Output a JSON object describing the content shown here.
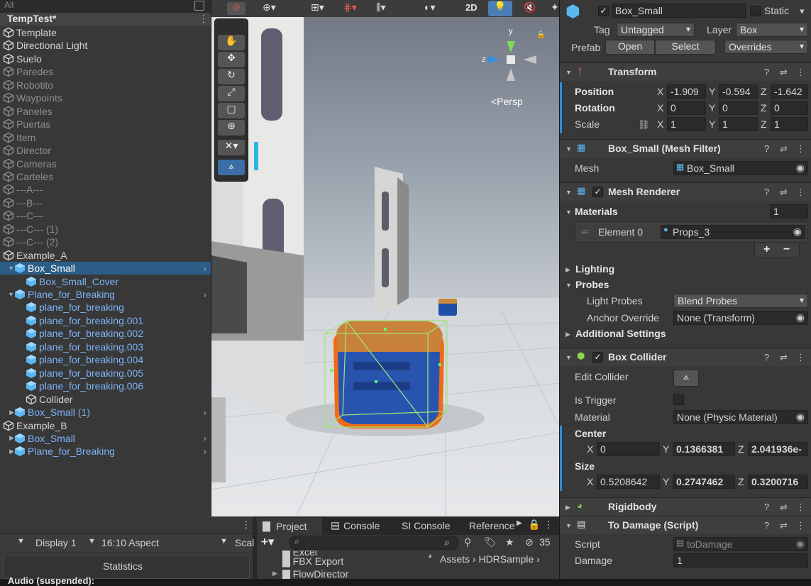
{
  "hierarchy": {
    "search_placeholder": "All",
    "scene_name": "TempTest*",
    "items": [
      {
        "label": "Template",
        "style": "normal"
      },
      {
        "label": "Directional Light",
        "style": "normal"
      },
      {
        "label": "Suelo",
        "style": "normal"
      },
      {
        "label": "Paredes",
        "style": "dim"
      },
      {
        "label": "Robotito",
        "style": "dim"
      },
      {
        "label": "Waypoints",
        "style": "dim"
      },
      {
        "label": "Paneles",
        "style": "dim"
      },
      {
        "label": "Puertas",
        "style": "dim"
      },
      {
        "label": "Item",
        "style": "dim"
      },
      {
        "label": "Director",
        "style": "dim"
      },
      {
        "label": "Cameras",
        "style": "dim"
      },
      {
        "label": "Carteles",
        "style": "dim"
      },
      {
        "label": "---A---",
        "style": "dim"
      },
      {
        "label": "---B---",
        "style": "dim"
      },
      {
        "label": "---C---",
        "style": "dim"
      },
      {
        "label": "---C--- (1)",
        "style": "dim"
      },
      {
        "label": "---C--- (2)",
        "style": "dim"
      },
      {
        "label": "Example_A",
        "style": "normal"
      },
      {
        "label": "Box_Small",
        "style": "selected"
      },
      {
        "label": "Box_Small_Cover",
        "style": "blue"
      },
      {
        "label": "Plane_for_Breaking",
        "style": "blue"
      },
      {
        "label": "plane_for_breaking",
        "style": "blue"
      },
      {
        "label": "plane_for_breaking.001",
        "style": "blue"
      },
      {
        "label": "plane_for_breaking.002",
        "style": "blue"
      },
      {
        "label": "plane_for_breaking.003",
        "style": "blue"
      },
      {
        "label": "plane_for_breaking.004",
        "style": "blue"
      },
      {
        "label": "plane_for_breaking.005",
        "style": "blue"
      },
      {
        "label": "plane_for_breaking.006",
        "style": "blue"
      },
      {
        "label": "Collider",
        "style": "normal"
      },
      {
        "label": "Box_Small (1)",
        "style": "blue"
      },
      {
        "label": "Example_B",
        "style": "normal"
      },
      {
        "label": "Box_Small",
        "style": "blue"
      },
      {
        "label": "Plane_for_Breaking",
        "style": "blue"
      }
    ]
  },
  "scene": {
    "toolbar_2d": "2D",
    "camera_mode": "<Persp",
    "gizmo_y": "y",
    "gizmo_z": "z"
  },
  "game": {
    "display": "Display 1",
    "aspect": "16:10 Aspect",
    "scale": "Scal",
    "stats_button": "Statistics",
    "audio_text": "Audio (suspended):"
  },
  "project": {
    "tabs": [
      "Project",
      "Console",
      "SI Console",
      "Reference"
    ],
    "folders": [
      "Excel",
      "FBX Export",
      "FlowDirector"
    ],
    "breadcrumb": "Assets › HDRSample ›",
    "hidden_count": "35",
    "search_placeholder": ""
  },
  "inspector": {
    "name": "Box_Small",
    "static_label": "Static",
    "tag_label": "Tag",
    "tag_value": "Untagged",
    "layer_label": "Layer",
    "layer_value": "Box",
    "prefab_label": "Prefab",
    "open_label": "Open",
    "select_label": "Select",
    "overrides_label": "Overrides",
    "transform": {
      "title": "Transform",
      "position_label": "Position",
      "rotation_label": "Rotation",
      "scale_label": "Scale",
      "position": {
        "x": "-1.909",
        "y": "-0.594",
        "z": "-1.642"
      },
      "rotation": {
        "x": "0",
        "y": "0",
        "z": "0"
      },
      "scale": {
        "x": "1",
        "y": "1",
        "z": "1"
      }
    },
    "mesh_filter": {
      "title": "Box_Small (Mesh Filter)",
      "mesh_label": "Mesh",
      "mesh_value": "Box_Small"
    },
    "mesh_renderer": {
      "title": "Mesh Renderer",
      "materials_label": "Materials",
      "materials_count": "1",
      "element_label": "Element 0",
      "element_value": "Props_3",
      "lighting_label": "Lighting",
      "probes_label": "Probes",
      "light_probes_label": "Light Probes",
      "light_probes_value": "Blend Probes",
      "anchor_label": "Anchor Override",
      "anchor_value": "None (Transform)",
      "additional_label": "Additional Settings"
    },
    "box_collider": {
      "title": "Box Collider",
      "edit_label": "Edit Collider",
      "trigger_label": "Is Trigger",
      "material_label": "Material",
      "material_value": "None (Physic Material)",
      "center_label": "Center",
      "center": {
        "x": "0",
        "y": "0.1366381",
        "z": "2.041936e-"
      },
      "size_label": "Size",
      "size": {
        "x": "0.5208642",
        "y": "0.2747462",
        "z": "0.3200716"
      }
    },
    "rigidbody": {
      "title": "Rigidbody"
    },
    "to_damage": {
      "title": "To Damage (Script)",
      "script_label": "Script",
      "script_value": "toDamage",
      "damage_label": "Damage",
      "damage_value": "1"
    },
    "axis_x": "X",
    "axis_y": "Y",
    "axis_z": "Z"
  }
}
